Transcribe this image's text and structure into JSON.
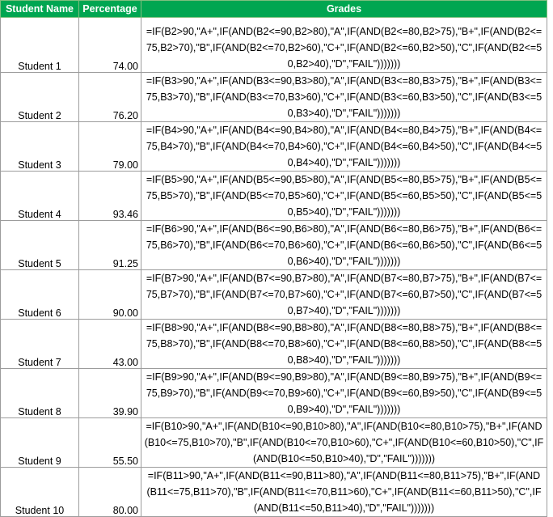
{
  "header": {
    "col_name": "Student Name",
    "col_pct": "Percentage",
    "col_grades": "Grades"
  },
  "rows": [
    {
      "name": "Student 1",
      "percentage": "74.00",
      "formula": "=IF(B2>90,\"A+\",IF(AND(B2<=90,B2>80),\"A\",IF(AND(B2<=80,B2>75),\"B+\",IF(AND(B2<=75,B2>70),\"B\",IF(AND(B2<=70,B2>60),\"C+\",IF(AND(B2<=60,B2>50),\"C\",IF(AND(B2<=50,B2>40),\"D\",\"FAIL\")))))))"
    },
    {
      "name": "Student 2",
      "percentage": "76.20",
      "formula": "=IF(B3>90,\"A+\",IF(AND(B3<=90,B3>80),\"A\",IF(AND(B3<=80,B3>75),\"B+\",IF(AND(B3<=75,B3>70),\"B\",IF(AND(B3<=70,B3>60),\"C+\",IF(AND(B3<=60,B3>50),\"C\",IF(AND(B3<=50,B3>40),\"D\",\"FAIL\")))))))"
    },
    {
      "name": "Student 3",
      "percentage": "79.00",
      "formula": "=IF(B4>90,\"A+\",IF(AND(B4<=90,B4>80),\"A\",IF(AND(B4<=80,B4>75),\"B+\",IF(AND(B4<=75,B4>70),\"B\",IF(AND(B4<=70,B4>60),\"C+\",IF(AND(B4<=60,B4>50),\"C\",IF(AND(B4<=50,B4>40),\"D\",\"FAIL\")))))))"
    },
    {
      "name": "Student 4",
      "percentage": "93.46",
      "formula": "=IF(B5>90,\"A+\",IF(AND(B5<=90,B5>80),\"A\",IF(AND(B5<=80,B5>75),\"B+\",IF(AND(B5<=75,B5>70),\"B\",IF(AND(B5<=70,B5>60),\"C+\",IF(AND(B5<=60,B5>50),\"C\",IF(AND(B5<=50,B5>40),\"D\",\"FAIL\")))))))"
    },
    {
      "name": "Student 5",
      "percentage": "91.25",
      "formula": "=IF(B6>90,\"A+\",IF(AND(B6<=90,B6>80),\"A\",IF(AND(B6<=80,B6>75),\"B+\",IF(AND(B6<=75,B6>70),\"B\",IF(AND(B6<=70,B6>60),\"C+\",IF(AND(B6<=60,B6>50),\"C\",IF(AND(B6<=50,B6>40),\"D\",\"FAIL\")))))))"
    },
    {
      "name": "Student 6",
      "percentage": "90.00",
      "formula": "=IF(B7>90,\"A+\",IF(AND(B7<=90,B7>80),\"A\",IF(AND(B7<=80,B7>75),\"B+\",IF(AND(B7<=75,B7>70),\"B\",IF(AND(B7<=70,B7>60),\"C+\",IF(AND(B7<=60,B7>50),\"C\",IF(AND(B7<=50,B7>40),\"D\",\"FAIL\")))))))"
    },
    {
      "name": "Student 7",
      "percentage": "43.00",
      "formula": "=IF(B8>90,\"A+\",IF(AND(B8<=90,B8>80),\"A\",IF(AND(B8<=80,B8>75),\"B+\",IF(AND(B8<=75,B8>70),\"B\",IF(AND(B8<=70,B8>60),\"C+\",IF(AND(B8<=60,B8>50),\"C\",IF(AND(B8<=50,B8>40),\"D\",\"FAIL\")))))))"
    },
    {
      "name": "Student 8",
      "percentage": "39.90",
      "formula": "=IF(B9>90,\"A+\",IF(AND(B9<=90,B9>80),\"A\",IF(AND(B9<=80,B9>75),\"B+\",IF(AND(B9<=75,B9>70),\"B\",IF(AND(B9<=70,B9>60),\"C+\",IF(AND(B9<=60,B9>50),\"C\",IF(AND(B9<=50,B9>40),\"D\",\"FAIL\")))))))"
    },
    {
      "name": "Student 9",
      "percentage": "55.50",
      "formula": "=IF(B10>90,\"A+\",IF(AND(B10<=90,B10>80),\"A\",IF(AND(B10<=80,B10>75),\"B+\",IF(AND(B10<=75,B10>70),\"B\",IF(AND(B10<=70,B10>60),\"C+\",IF(AND(B10<=60,B10>50),\"C\",IF(AND(B10<=50,B10>40),\"D\",\"FAIL\")))))))"
    },
    {
      "name": "Student 10",
      "percentage": "80.00",
      "formula": "=IF(B11>90,\"A+\",IF(AND(B11<=90,B11>80),\"A\",IF(AND(B11<=80,B11>75),\"B+\",IF(AND(B11<=75,B11>70),\"B\",IF(AND(B11<=70,B11>60),\"C+\",IF(AND(B11<=60,B11>50),\"C\",IF(AND(B11<=50,B11>40),\"D\",\"FAIL\")))))))"
    }
  ],
  "colors": {
    "header_bg": "#00a651",
    "header_text": "#ffffff",
    "grid": "#9c9c9c"
  }
}
